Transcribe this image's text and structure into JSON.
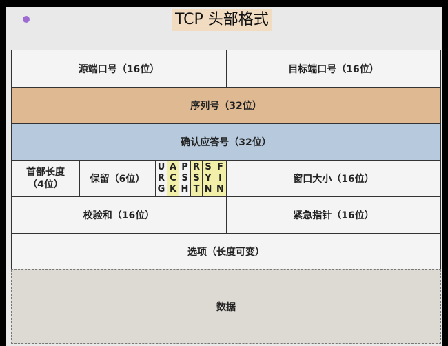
{
  "title": "TCP 头部格式",
  "rows": {
    "src_port": "源端口号（16位）",
    "dst_port": "目标端口号（16位）",
    "seq": "序列号（32位）",
    "ack": "确认应答号（32位）",
    "header_len_line1": "首部长度",
    "header_len_line2": "（4位）",
    "reserved": "保留（6位）",
    "flags": [
      {
        "letters": [
          "U",
          "R",
          "G"
        ],
        "highlight": false
      },
      {
        "letters": [
          "A",
          "C",
          "K"
        ],
        "highlight": true
      },
      {
        "letters": [
          "P",
          "S",
          "H"
        ],
        "highlight": false
      },
      {
        "letters": [
          "R",
          "S",
          "T"
        ],
        "highlight": true
      },
      {
        "letters": [
          "S",
          "Y",
          "N"
        ],
        "highlight": true
      },
      {
        "letters": [
          "F",
          "I",
          "N"
        ],
        "highlight": true
      }
    ],
    "window": "窗口大小（16位）",
    "checksum": "校验和（16位）",
    "urgent": "紧急指针（16位）",
    "options": "选项（长度可变）",
    "data": "数据"
  },
  "colors": {
    "seq_fill": "#dfb991",
    "ack_fill": "#b6c9dd",
    "flag_highlight": "#f2f0a8",
    "data_fill": "#ddd9d3",
    "dot": "#9d6bd1"
  }
}
